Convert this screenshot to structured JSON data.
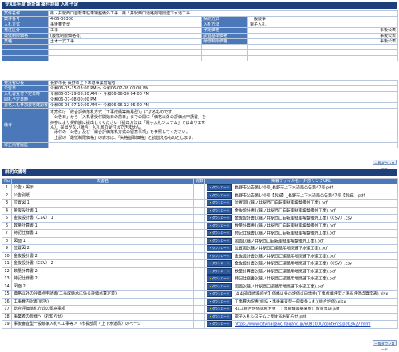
{
  "section1_title": "令和6年度 設計課 案件詳細 入札予定",
  "project": {
    "name_label": "案件名称",
    "name": "篠ノ井駅西口自転車駐車場整備外工事・篠ノ井駅西口道路用地関連下水道工事",
    "no_label": "案件番号",
    "no": "4-06-00300",
    "contract_method_label": "契約方式",
    "contract_method": "一般競争",
    "bid_method_label": "入札方式",
    "bid_method": "事後審査型",
    "bid_form_label": "入札方法",
    "bid_form": "電子入札",
    "type_label": "発注区分",
    "type": "工事",
    "estimated_price_label": "予定価格",
    "estimated_price": "事後公表",
    "minimum_label": "最低制限価格",
    "minimum": "(最低制限価格有)",
    "survey_label": "調査基準価格",
    "survey": "事後公表",
    "category_label": "業種",
    "category": "土木一式工事",
    "min_limit_label": "最低制限価格",
    "min_limit": "事後公表"
  },
  "details": {
    "orderer_label": "発注者の長",
    "orderer": "長野市長 長野市上下水道事業管理者",
    "announce_label": "公告日",
    "announce": "令和06-05-15 03:00 PM  〜  令和06-07-08 00:00 PM",
    "bid_period_label": "入札書受付予定日時",
    "bid_period": "令和06-05-29 08:30 AM  〜  令和06-06-30 04:00 PM",
    "open_label": "開札予定日時",
    "open": "令和06-07-08 00:00 PM",
    "confirm_label": "資格入札参加資格確認書受付日時",
    "confirm": "令和06-06-07 10:00 AM  〜  令和06-06-12 05:00 PM",
    "notes_label": "備考",
    "notes": [
      "本案件は「総合評価落札方式（工事成績等簡易型）」によるものです。",
      "「公告日」から「入札書受付開始日の前日」までの間に「価格以外の評価点申請書」を",
      "持参により契約課に提出してください（提出方法は「電子入札システム」ではありませ",
      "ん）。提出がない場合、入札書の受付はできません。",
      "　添付の「公告」及び「総合評価落札方式の留意事項」を参照してください。",
      "　上記の「最低制限価格」の表示は、「失格基準価格」と読替えるものとします。"
    ],
    "history_label": "修正内容履歴",
    "history": ""
  },
  "top_button": "一覧ダウンロード",
  "section2_title": "説明文書等",
  "doc_headers": {
    "no": "No",
    "name": "文書名",
    "pages": "頁数",
    "file": "掲載ファイル名／外部リンクURL"
  },
  "download_label": "ダウンロード",
  "docs": [
    {
      "no": "1",
      "name": "公告・掲示",
      "file": "長野市公告第140号_長野市上下水道局公告第47号.pdf"
    },
    {
      "no": "2",
      "name": "公告別紙",
      "file": "長野市公告第140号【別紙】_長野市上下水道局公告第47号【別紙】.pdf"
    },
    {
      "no": "3",
      "name": "位置図 1",
      "file": "位置図1(篠ノ井駅西口自転車駐車場整備外工事).pdf"
    },
    {
      "no": "4",
      "name": "金抜設計書 1",
      "file": "金抜設計書1(篠ノ井駅西口自転車駐車場整備外工事).pdf"
    },
    {
      "no": "5",
      "name": "金抜設計書（CSV） 1",
      "file": "金抜設計書1(篠ノ井駅西口自転車駐車場整備外工事)（CSV）.csv"
    },
    {
      "no": "6",
      "name": "数量計算書 1",
      "file": "数量計算書1(篠ノ井駅西口自転車駐車場整備外工事).pdf"
    },
    {
      "no": "7",
      "name": "特記仕様書 1",
      "file": "特記仕様書1(篠ノ井駅西口自転車駐車場整備外工事).pdf"
    },
    {
      "no": "8",
      "name": "図面 1",
      "file": "図面1(篠ノ井駅西口自転車駐車場整備外工事).pdf"
    },
    {
      "no": "9",
      "name": "位置図 2",
      "file": "位置図2(篠ノ井駅西口道路用地関連下水道工事).pdf"
    },
    {
      "no": "10",
      "name": "金抜設計書 2",
      "file": "金抜設計書2(篠ノ井駅西口道路用地関連下水道工事).pdf"
    },
    {
      "no": "11",
      "name": "金抜設計書（CSV） 2",
      "file": "金抜設計書2(篠ノ井駅西口道路用地関連下水道工事)（CSV）.csv"
    },
    {
      "no": "12",
      "name": "数量計算書 2",
      "file": "数量計算書2(篠ノ井駅西口道路用地関連下水道工事).pdf"
    },
    {
      "no": "13",
      "name": "特記仕様書 2",
      "file": "特記仕様書2(篠ノ井駅西口道路用地関連下水道工事).pdf"
    },
    {
      "no": "14",
      "name": "図面 2",
      "file": "図面2(篠ノ井駅西口道路用地関連下水道工事).pdf"
    },
    {
      "no": "15",
      "name": "価格以外の評価点申請書(工事成績承に係る評価点算定表)",
      "file": "[4.4]適用標準様式】価格以外の評価点申請書(工事成績評定に係る評価点算定表).xlsx"
    },
    {
      "no": "16",
      "name": "工事費内訳書(総括)",
      "file": "工事費内訳書(総括・事後審査型一般競争入札)(総合評価).xlsx"
    },
    {
      "no": "17",
      "name": "総合評価落札方式の留意事項",
      "file": "R4-4総合評価落札方式（工事成績等簡易型）留意事項.pdf"
    },
    {
      "no": "18",
      "name": "事業者の皆様へ（お知らせ）",
      "file": "電子入札システムに関するお知らせ.pdf"
    },
    {
      "no": "19",
      "name": "事後審査型一般競争入札＜工事等＞（市長部局・上下水道局）のページ",
      "file": "https://www.city.nagano.nagano.jp/n081000/contents/p003627.html",
      "link": true
    }
  ],
  "bottom_button": "一覧ダウンロード"
}
